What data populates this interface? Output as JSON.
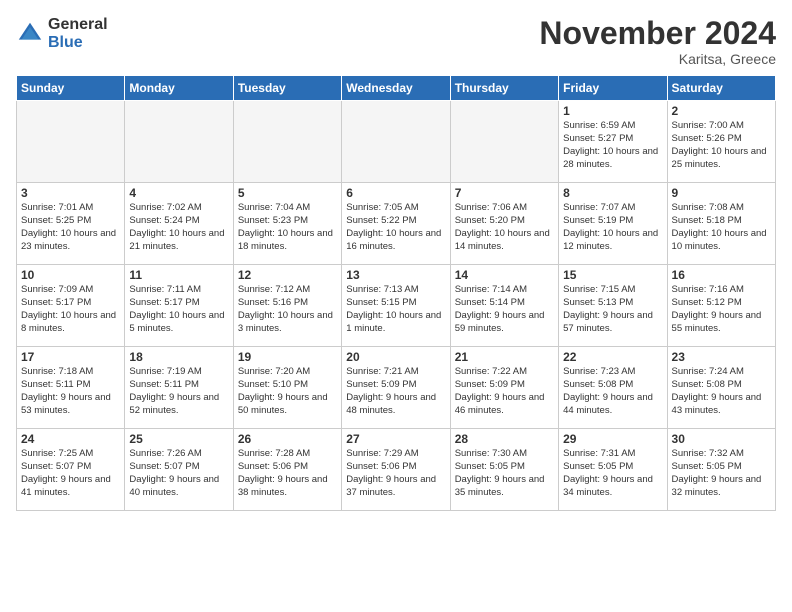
{
  "logo": {
    "general": "General",
    "blue": "Blue"
  },
  "title": "November 2024",
  "location": "Karitsa, Greece",
  "days_of_week": [
    "Sunday",
    "Monday",
    "Tuesday",
    "Wednesday",
    "Thursday",
    "Friday",
    "Saturday"
  ],
  "weeks": [
    [
      {
        "day": "",
        "info": ""
      },
      {
        "day": "",
        "info": ""
      },
      {
        "day": "",
        "info": ""
      },
      {
        "day": "",
        "info": ""
      },
      {
        "day": "",
        "info": ""
      },
      {
        "day": "1",
        "info": "Sunrise: 6:59 AM\nSunset: 5:27 PM\nDaylight: 10 hours and 28 minutes."
      },
      {
        "day": "2",
        "info": "Sunrise: 7:00 AM\nSunset: 5:26 PM\nDaylight: 10 hours and 25 minutes."
      }
    ],
    [
      {
        "day": "3",
        "info": "Sunrise: 7:01 AM\nSunset: 5:25 PM\nDaylight: 10 hours and 23 minutes."
      },
      {
        "day": "4",
        "info": "Sunrise: 7:02 AM\nSunset: 5:24 PM\nDaylight: 10 hours and 21 minutes."
      },
      {
        "day": "5",
        "info": "Sunrise: 7:04 AM\nSunset: 5:23 PM\nDaylight: 10 hours and 18 minutes."
      },
      {
        "day": "6",
        "info": "Sunrise: 7:05 AM\nSunset: 5:22 PM\nDaylight: 10 hours and 16 minutes."
      },
      {
        "day": "7",
        "info": "Sunrise: 7:06 AM\nSunset: 5:20 PM\nDaylight: 10 hours and 14 minutes."
      },
      {
        "day": "8",
        "info": "Sunrise: 7:07 AM\nSunset: 5:19 PM\nDaylight: 10 hours and 12 minutes."
      },
      {
        "day": "9",
        "info": "Sunrise: 7:08 AM\nSunset: 5:18 PM\nDaylight: 10 hours and 10 minutes."
      }
    ],
    [
      {
        "day": "10",
        "info": "Sunrise: 7:09 AM\nSunset: 5:17 PM\nDaylight: 10 hours and 8 minutes."
      },
      {
        "day": "11",
        "info": "Sunrise: 7:11 AM\nSunset: 5:17 PM\nDaylight: 10 hours and 5 minutes."
      },
      {
        "day": "12",
        "info": "Sunrise: 7:12 AM\nSunset: 5:16 PM\nDaylight: 10 hours and 3 minutes."
      },
      {
        "day": "13",
        "info": "Sunrise: 7:13 AM\nSunset: 5:15 PM\nDaylight: 10 hours and 1 minute."
      },
      {
        "day": "14",
        "info": "Sunrise: 7:14 AM\nSunset: 5:14 PM\nDaylight: 9 hours and 59 minutes."
      },
      {
        "day": "15",
        "info": "Sunrise: 7:15 AM\nSunset: 5:13 PM\nDaylight: 9 hours and 57 minutes."
      },
      {
        "day": "16",
        "info": "Sunrise: 7:16 AM\nSunset: 5:12 PM\nDaylight: 9 hours and 55 minutes."
      }
    ],
    [
      {
        "day": "17",
        "info": "Sunrise: 7:18 AM\nSunset: 5:11 PM\nDaylight: 9 hours and 53 minutes."
      },
      {
        "day": "18",
        "info": "Sunrise: 7:19 AM\nSunset: 5:11 PM\nDaylight: 9 hours and 52 minutes."
      },
      {
        "day": "19",
        "info": "Sunrise: 7:20 AM\nSunset: 5:10 PM\nDaylight: 9 hours and 50 minutes."
      },
      {
        "day": "20",
        "info": "Sunrise: 7:21 AM\nSunset: 5:09 PM\nDaylight: 9 hours and 48 minutes."
      },
      {
        "day": "21",
        "info": "Sunrise: 7:22 AM\nSunset: 5:09 PM\nDaylight: 9 hours and 46 minutes."
      },
      {
        "day": "22",
        "info": "Sunrise: 7:23 AM\nSunset: 5:08 PM\nDaylight: 9 hours and 44 minutes."
      },
      {
        "day": "23",
        "info": "Sunrise: 7:24 AM\nSunset: 5:08 PM\nDaylight: 9 hours and 43 minutes."
      }
    ],
    [
      {
        "day": "24",
        "info": "Sunrise: 7:25 AM\nSunset: 5:07 PM\nDaylight: 9 hours and 41 minutes."
      },
      {
        "day": "25",
        "info": "Sunrise: 7:26 AM\nSunset: 5:07 PM\nDaylight: 9 hours and 40 minutes."
      },
      {
        "day": "26",
        "info": "Sunrise: 7:28 AM\nSunset: 5:06 PM\nDaylight: 9 hours and 38 minutes."
      },
      {
        "day": "27",
        "info": "Sunrise: 7:29 AM\nSunset: 5:06 PM\nDaylight: 9 hours and 37 minutes."
      },
      {
        "day": "28",
        "info": "Sunrise: 7:30 AM\nSunset: 5:05 PM\nDaylight: 9 hours and 35 minutes."
      },
      {
        "day": "29",
        "info": "Sunrise: 7:31 AM\nSunset: 5:05 PM\nDaylight: 9 hours and 34 minutes."
      },
      {
        "day": "30",
        "info": "Sunrise: 7:32 AM\nSunset: 5:05 PM\nDaylight: 9 hours and 32 minutes."
      }
    ]
  ]
}
